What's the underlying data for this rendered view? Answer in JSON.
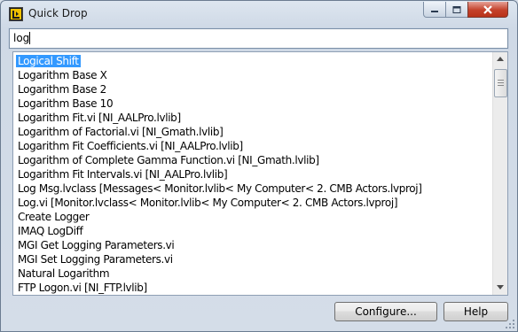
{
  "window": {
    "title": "Quick Drop"
  },
  "search": {
    "value": "log"
  },
  "results": {
    "selected_index": 0,
    "items": [
      "Logical Shift",
      "Logarithm Base X",
      "Logarithm Base 2",
      "Logarithm Base 10",
      "Logarithm Fit.vi [NI_AALPro.lvlib]",
      "Logarithm of Factorial.vi [NI_Gmath.lvlib]",
      "Logarithm Fit Coefficients.vi [NI_AALPro.lvlib]",
      "Logarithm of Complete Gamma Function.vi [NI_Gmath.lvlib]",
      "Logarithm Fit Intervals.vi [NI_AALPro.lvlib]",
      "Log Msg.lvclass [Messages< Monitor.lvlib< My Computer< 2. CMB Actors.lvproj]",
      "Log.vi [Monitor.lvclass< Monitor.lvlib< My Computer< 2. CMB Actors.lvproj]",
      "Create Logger",
      "IMAQ LogDiff",
      "MGI Get Logging Parameters.vi",
      "MGI Set Logging Parameters.vi",
      "Natural Logarithm",
      "FTP Logon.vi [NI_FTP.lvlib]"
    ]
  },
  "buttons": {
    "configure": "Configure...",
    "help": "Help"
  },
  "icons": {
    "app": "labview-app-icon",
    "minimize": "minimize-icon",
    "maximize": "maximize-icon",
    "close": "close-icon"
  },
  "colors": {
    "selection": "#3399ff",
    "close_button": "#c4412a"
  }
}
